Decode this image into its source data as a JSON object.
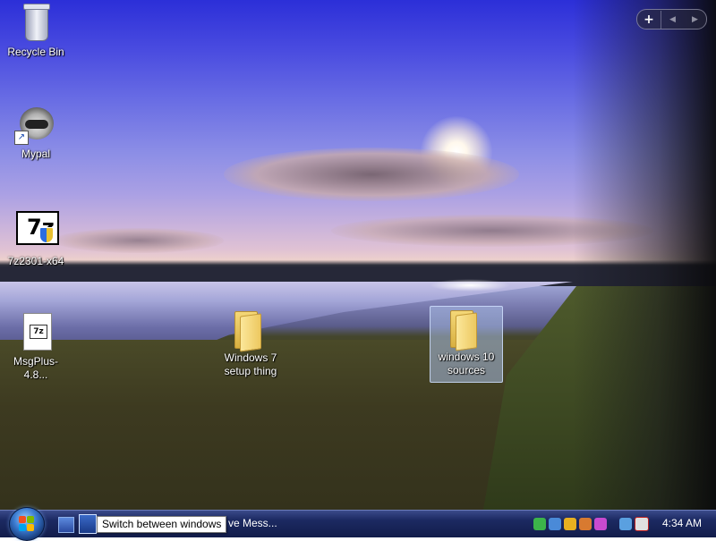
{
  "desktop": {
    "icons": [
      {
        "label": "Recycle Bin"
      },
      {
        "label": "Mypal"
      },
      {
        "label": "7z2301-x64"
      },
      {
        "label": "MsgPlus-4.8..."
      },
      {
        "label": "Windows 7\nsetup thing"
      },
      {
        "label": "windows 10\nsources"
      }
    ],
    "gadget_bar": {
      "add_symbol": "+",
      "prev_symbol": "◀",
      "next_symbol": "▶"
    }
  },
  "taskbar": {
    "tooltip": "Switch between windows",
    "task_button_text": "ve Mess...",
    "clock": "4:34 AM"
  },
  "colors": {
    "taskbar": "#1c2a62",
    "selection": "#aabee6"
  }
}
